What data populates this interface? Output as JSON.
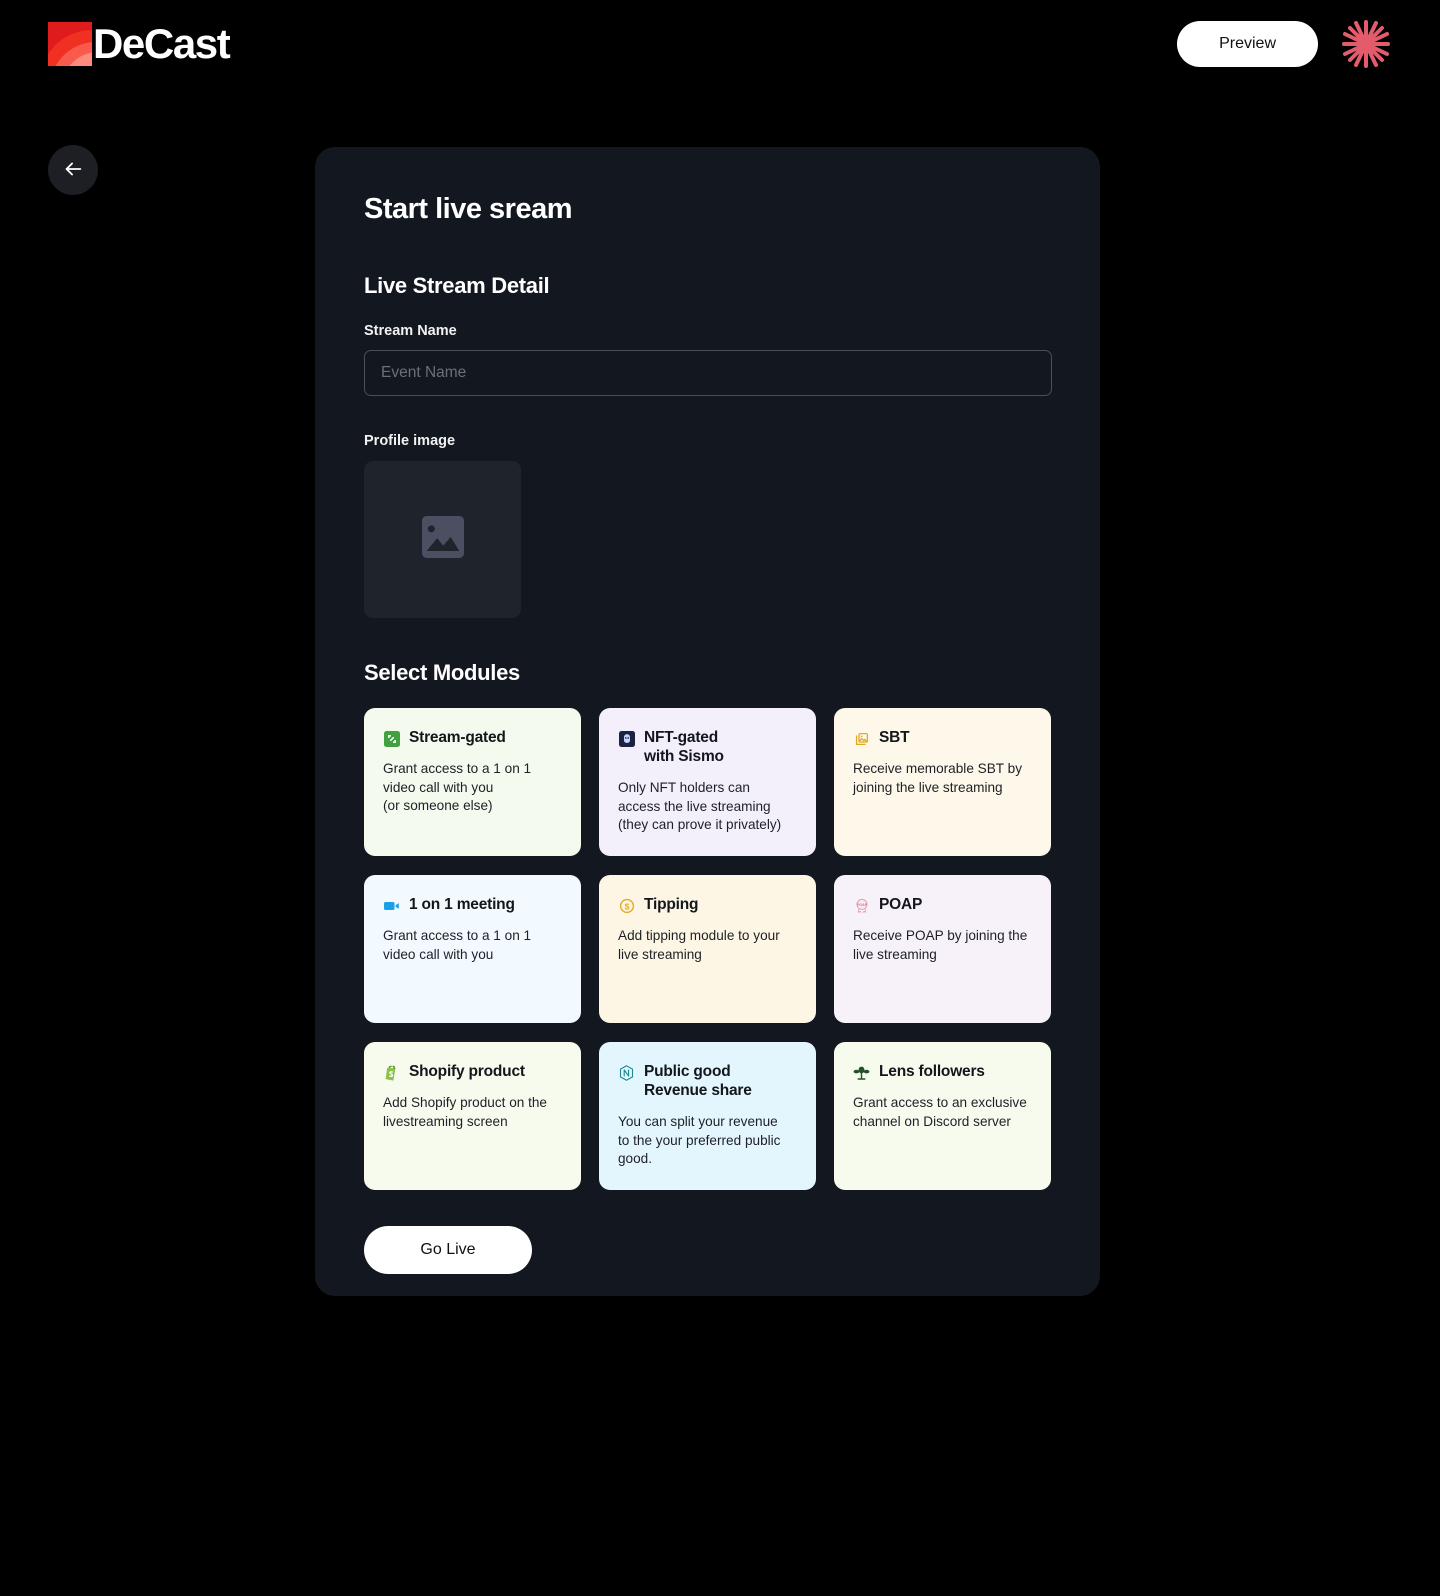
{
  "brand": {
    "name": "DeCast",
    "logo_icon": "decast-logo-icon",
    "logo_color": "#e01b1b"
  },
  "topbar": {
    "preview_label": "Preview",
    "avatar_icon": "starburst-avatar-icon",
    "avatar_color": "#e35c6b"
  },
  "back_button": {
    "icon": "arrow-left-icon",
    "label": ""
  },
  "card": {
    "title": "Start live sream",
    "section_title": "Live Stream Detail",
    "stream_name": {
      "label": "Stream Name",
      "value": "",
      "placeholder": "Event Name"
    },
    "profile_image": {
      "label": "Profile image",
      "icon": "image-placeholder-icon"
    },
    "modules_title": "Select Modules",
    "modules": [
      {
        "title": "Stream-gated",
        "desc": "Grant access to a 1 on 1\nvideo call with you\n(or someone else)",
        "icon": "stream-gated-icon",
        "bg": "#f4faed",
        "icon_color": "#3fa23f"
      },
      {
        "title": "NFT-gated\nwith Sismo",
        "desc": "Only NFT holders can\naccess the live streaming\n(they can prove it privately)",
        "icon": "sismo-icon",
        "bg": "#f4f0fb",
        "icon_color": "#1c2242"
      },
      {
        "title": "SBT",
        "desc": "Receive memorable SBT by\njoining the live streaming",
        "icon": "sbt-frame-icon",
        "bg": "#fdf8e9",
        "icon_color": "#e0ab23"
      },
      {
        "title": "1 on 1 meeting",
        "desc": "Grant access to a 1 on 1\nvideo call with you",
        "icon": "video-camera-icon",
        "bg": "#f3faff",
        "icon_color": "#1aa0e8"
      },
      {
        "title": "Tipping",
        "desc": "Add tipping module to your\nlive streaming",
        "icon": "coin-dollar-icon",
        "bg": "#fdf6e4",
        "icon_color": "#e0ab23"
      },
      {
        "title": "POAP",
        "desc": "Receive POAP by joining the\nlive streaming",
        "icon": "poap-badge-icon",
        "bg": "#f7f2fa",
        "icon_color": "#e8a0b8"
      },
      {
        "title": "Shopify product",
        "desc": "Add Shopify product on the\nlivestreaming screen",
        "icon": "shopify-bag-icon",
        "bg": "#f6fbee",
        "icon_color": "#73b13a"
      },
      {
        "title": "Public good\nRevenue share",
        "desc": "You can split your revenue\nto the your preferred public\ngood.",
        "icon": "hexagon-nf-icon",
        "bg": "#e3f6fd",
        "icon_color": "#1e8a92"
      },
      {
        "title": "Lens followers",
        "desc": "Grant access to an exclusive\nchannel on Discord server",
        "icon": "lens-sprout-icon",
        "bg": "#f6fbee",
        "icon_color": "#24502a"
      }
    ],
    "go_live_label": "Go Live"
  }
}
